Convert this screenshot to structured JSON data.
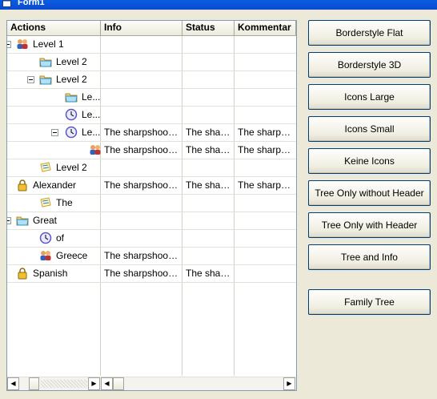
{
  "window": {
    "title": "Form1"
  },
  "columns": [
    "Actions",
    "Info",
    "Status",
    "Kommentar"
  ],
  "rows": [
    {
      "label": "Level 1",
      "icon": "people-icon",
      "expander": "collapse",
      "info": "",
      "status": "",
      "comment": ""
    },
    {
      "label": "Level 2",
      "icon": "folder-icon",
      "expander": "",
      "info": "",
      "status": "",
      "comment": ""
    },
    {
      "label": "Level 2",
      "icon": "folder-icon",
      "expander": "collapse",
      "info": "",
      "status": "",
      "comment": ""
    },
    {
      "label": "Le...",
      "icon": "folder-icon",
      "expander": "",
      "info": "",
      "status": "",
      "comment": ""
    },
    {
      "label": "Le...",
      "icon": "clock-icon",
      "expander": "",
      "info": "",
      "status": "",
      "comment": ""
    },
    {
      "label": "Le...",
      "icon": "clock-icon",
      "expander": "collapse",
      "info": "The sharpshooter",
      "status": "The sharp...",
      "comment": "The sharpsho..."
    },
    {
      "label": "",
      "icon": "people-icon",
      "expander": "",
      "info": "The sharpshooter",
      "status": "The sharp...",
      "comment": "The sharpsho..."
    },
    {
      "label": "Level 2",
      "icon": "note-icon",
      "expander": "",
      "info": "",
      "status": "",
      "comment": ""
    },
    {
      "label": "Alexander",
      "icon": "lock-icon",
      "expander": "",
      "info": "The sharpshooter",
      "status": "The sharp...",
      "comment": "The sharpsho..."
    },
    {
      "label": "The",
      "icon": "note-icon",
      "expander": "",
      "info": "",
      "status": "",
      "comment": ""
    },
    {
      "label": "Great",
      "icon": "folder-icon",
      "expander": "collapse",
      "info": "",
      "status": "",
      "comment": ""
    },
    {
      "label": "of",
      "icon": "clock-icon",
      "expander": "",
      "info": "",
      "status": "",
      "comment": ""
    },
    {
      "label": "Greece",
      "icon": "people-icon",
      "expander": "",
      "info": "The sharpshooter",
      "status": "",
      "comment": ""
    },
    {
      "label": "Spanish",
      "icon": "lock-icon",
      "expander": "",
      "info": "The sharpshooter",
      "status": "The sharp...",
      "comment": ""
    }
  ],
  "buttons": [
    "Borderstyle Flat",
    "Borderstyle 3D",
    "Icons Large",
    "Icons Small",
    "Keine Icons",
    "Tree Only without Header",
    "Tree Only with Header",
    "Tree and Info",
    "Family Tree"
  ]
}
